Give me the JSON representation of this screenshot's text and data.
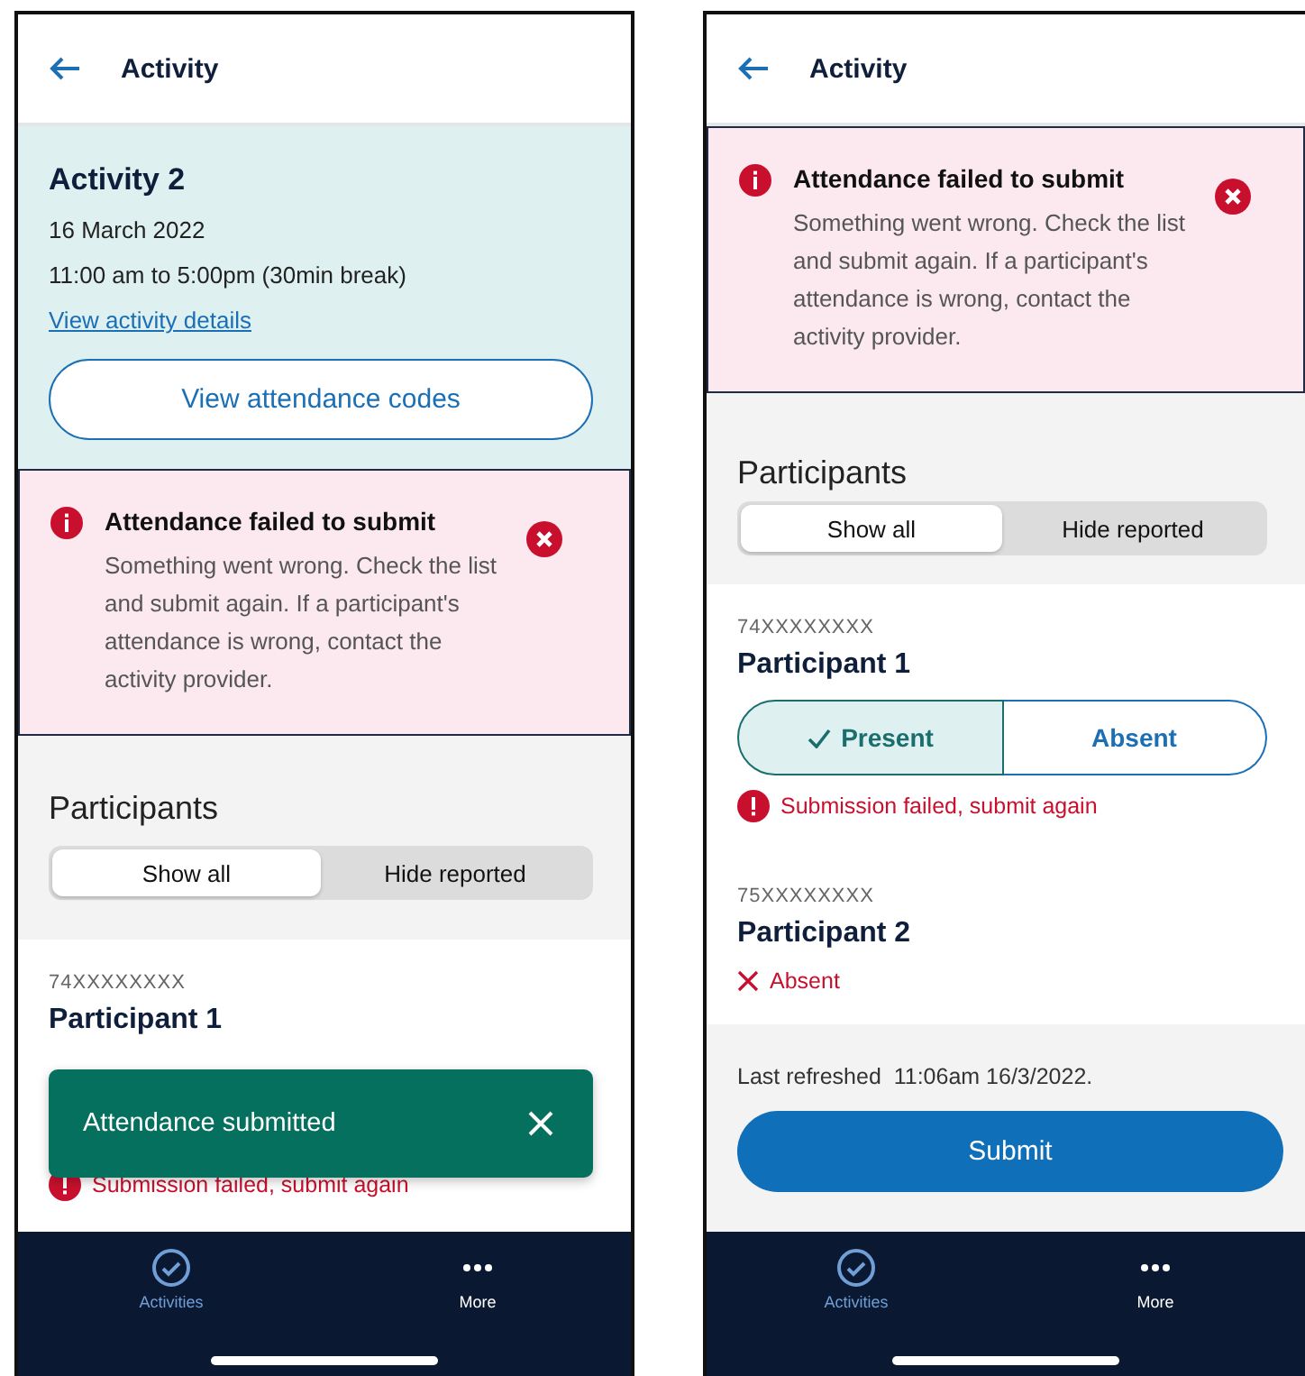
{
  "screens": [
    {
      "header": {
        "title": "Activity"
      },
      "activity": {
        "title": "Activity 2",
        "date": "16 March 2022",
        "time": "11:00 am to 5:00pm (30min break)",
        "link": "View activity details",
        "button": "View attendance codes"
      },
      "alert": {
        "title": "Attendance failed to submit",
        "message": "Something went wrong. Check the list and submit again. If a participant's attendance is wrong, contact the activity provider."
      },
      "participants": {
        "heading": "Participants",
        "filters": [
          {
            "label": "Show all",
            "selected": true
          },
          {
            "label": "Hide reported",
            "selected": false
          }
        ]
      },
      "list": [
        {
          "id": "74XXXXXXXX",
          "name": "Participant 1",
          "error": "Submission failed, submit again"
        }
      ],
      "toast": {
        "message": "Attendance submitted"
      },
      "nav": [
        {
          "label": "Activities",
          "kind": "check",
          "selected": true
        },
        {
          "label": "More",
          "kind": "dots",
          "selected": false
        }
      ]
    },
    {
      "header": {
        "title": "Activity"
      },
      "alert": {
        "title": "Attendance failed to submit",
        "message": "Something went wrong. Check the list and submit again. If a participant's attendance is wrong, contact the activity provider."
      },
      "participants": {
        "heading": "Participants",
        "filters": [
          {
            "label": "Show all",
            "selected": true
          },
          {
            "label": "Hide reported",
            "selected": false
          }
        ]
      },
      "list": [
        {
          "id": "74XXXXXXXX",
          "name": "Participant 1",
          "attendance": {
            "kind": "toggle",
            "options": [
              {
                "label": "Present",
                "selected": true
              },
              {
                "label": "Absent",
                "selected": false
              }
            ]
          },
          "error": "Submission failed, submit again"
        },
        {
          "id": "75XXXXXXXX",
          "name": "Participant 2",
          "attendance": {
            "kind": "status",
            "label": "Absent"
          }
        }
      ],
      "footer": {
        "refreshed": "Last refreshed  11:06am 16/3/2022.",
        "button": "Submit"
      },
      "nav": [
        {
          "label": "Activities",
          "kind": "check",
          "selected": true
        },
        {
          "label": "More",
          "kind": "dots",
          "selected": false
        }
      ]
    }
  ]
}
